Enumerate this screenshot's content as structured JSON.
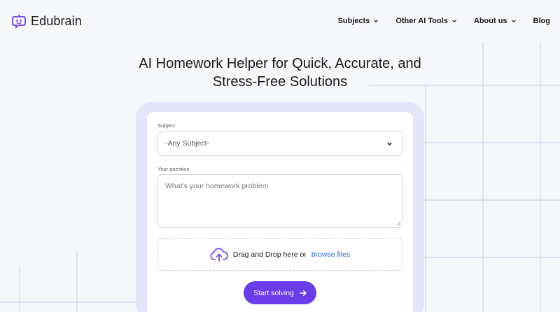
{
  "brand": {
    "name": "Edubrain",
    "logo_icon": "robot-chat-icon",
    "accent": "#7b4fe8"
  },
  "nav": {
    "items": [
      {
        "label": "Subjects",
        "dropdown": true
      },
      {
        "label": "Other AI Tools",
        "dropdown": true
      },
      {
        "label": "About us",
        "dropdown": true
      },
      {
        "label": "Blog",
        "dropdown": false
      }
    ]
  },
  "hero": {
    "title_line1": "AI Homework Helper for Quick, Accurate, and",
    "title_line2": "Stress-Free Solutions"
  },
  "form": {
    "subject_label": "Subject",
    "subject_value": "-Any Subject-",
    "question_label": "Your question",
    "question_placeholder": "What’s your homework problem",
    "upload_text": "Drag and Drop here or",
    "upload_link": "browse files",
    "submit_label": "Start solving"
  },
  "colors": {
    "primary_button": "#6a3de8",
    "link": "#2f6fd6",
    "card_frame": "#e6e5fa"
  }
}
